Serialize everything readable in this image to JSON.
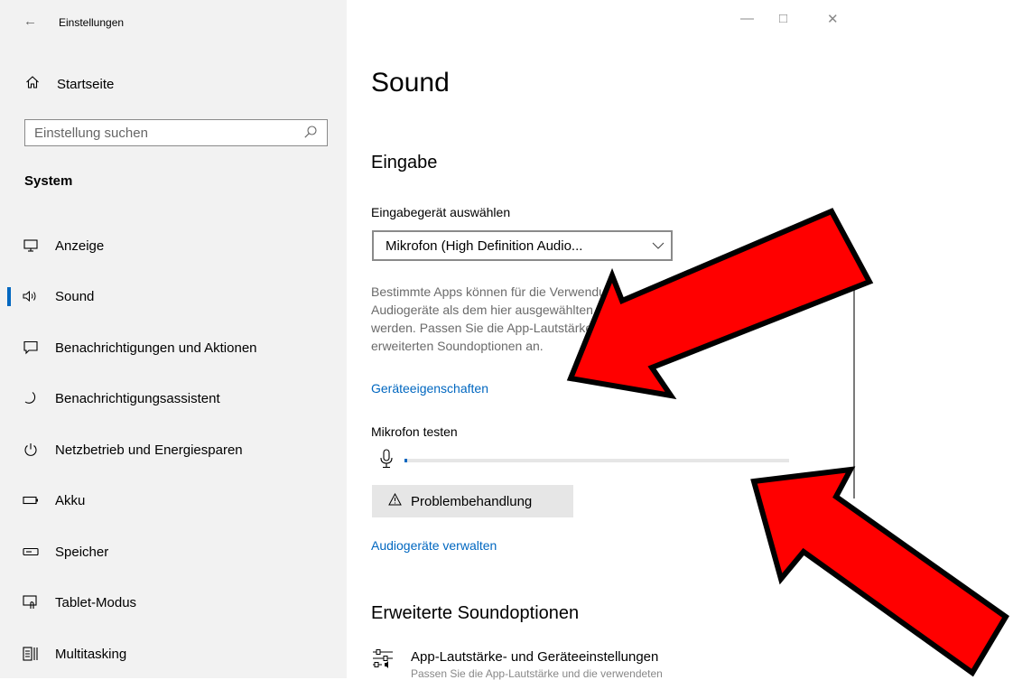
{
  "overlay": {
    "caption_text": "· · · „ · · „ · · „ „ · · ·"
  },
  "window": {
    "title": "Einstellungen",
    "back_icon": "←",
    "minimize": "—",
    "maximize": "□",
    "close": "✕"
  },
  "sidebar": {
    "home_label": "Startseite",
    "search_placeholder": "Einstellung suchen",
    "group_label": "System",
    "items": [
      {
        "label": "Anzeige",
        "icon": "monitor-icon"
      },
      {
        "label": "Sound",
        "icon": "speaker-icon",
        "active": true
      },
      {
        "label": "Benachrichtigungen und Aktionen",
        "icon": "notification-icon"
      },
      {
        "label": "Benachrichtigungsassistent",
        "icon": "moon-icon"
      },
      {
        "label": "Netzbetrieb und Energiesparen",
        "icon": "power-icon"
      },
      {
        "label": "Akku",
        "icon": "battery-icon"
      },
      {
        "label": "Speicher",
        "icon": "storage-icon"
      },
      {
        "label": "Tablet-Modus",
        "icon": "tablet-mode-icon"
      },
      {
        "label": "Multitasking",
        "icon": "multitasking-icon"
      }
    ]
  },
  "main": {
    "title": "Sound",
    "section_input": "Eingabe",
    "device_select_label": "Eingabegerät auswählen",
    "device_selected": "Mikrofon (High Definition Audio...",
    "info_lines": [
      "Bestimmte Apps können für die Verwendung",
      "Audiogeräte als dem hier ausgewählten",
      "werden. Passen Sie die App-Lautstärke in den",
      "erweiterten Soundoptionen an."
    ],
    "device_properties_link": "Geräteeigenschaften",
    "mic_test_label": "Mikrofon testen",
    "mic_level_fraction": 0.007,
    "troubleshoot_label": "Problembehandlung",
    "manage_devices_link": "Audiogeräte verwalten",
    "section_advanced": "Erweiterte Soundoptionen",
    "app_volume_title": "App-Lautstärke- und Geräteeinstellungen",
    "app_volume_subtitle": "Passen Sie die App-Lautstärke und die verwendeten"
  },
  "colors": {
    "accent": "#0067c0",
    "arrow_fill": "#ff0000",
    "arrow_outline": "#000000"
  }
}
